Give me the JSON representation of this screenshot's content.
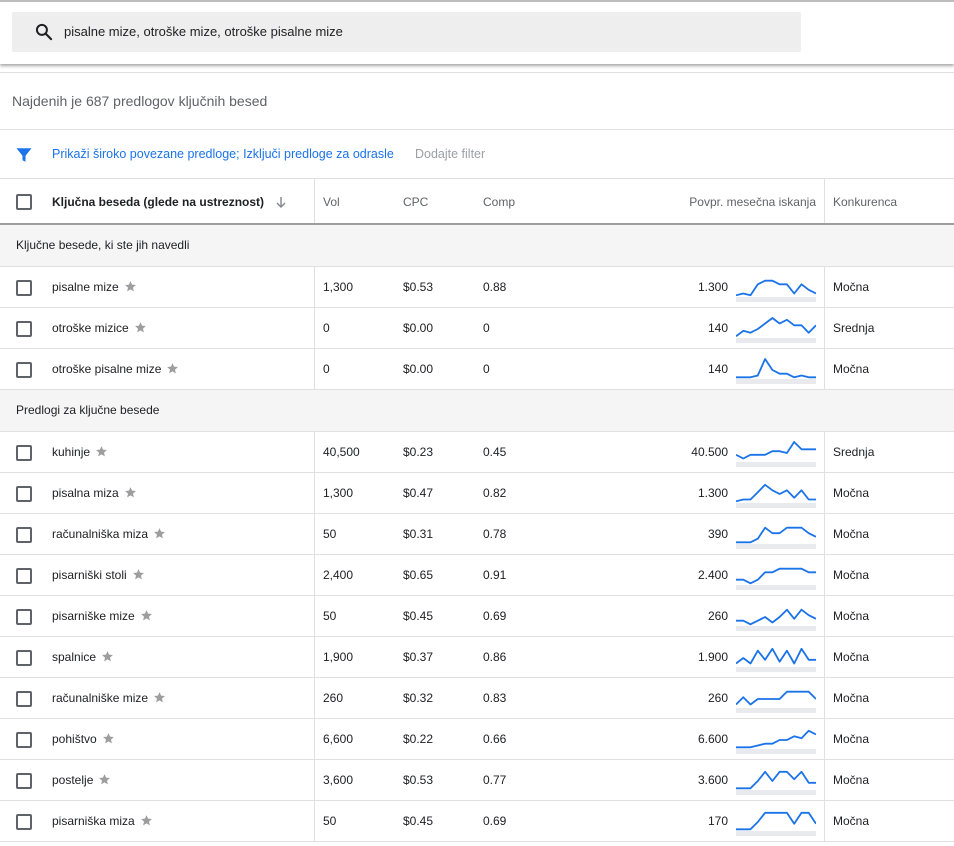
{
  "search": {
    "query": "pisalne mize, otroške mize, otroške pisalne mize",
    "icon": "search-icon"
  },
  "summary": "Najdenih je 687 predlogov ključnih besed",
  "filters": {
    "active": "Prikaži široko povezane predloge; Izključi predloge za odrasle",
    "add": "Dodajte filter",
    "icon": "filter-icon",
    "accent": "#1a73e8"
  },
  "columns": {
    "keyword": "Ključna beseda (glede na ustreznost)",
    "vol": "Vol",
    "cpc": "CPC",
    "comp": "Comp",
    "avg": "Povpr. mesečna iskanja",
    "competition": "Konkurenca"
  },
  "sections": [
    {
      "label": "Ključne besede, ki ste jih navedli",
      "rows": [
        {
          "keyword": "pisalne mize",
          "vol": "1,300",
          "cpc": "$0.53",
          "comp": "0.88",
          "avg": "1.300",
          "competition": "Močna",
          "trend": [
            2,
            3,
            2,
            8,
            10,
            10,
            8,
            8,
            3,
            8,
            5,
            3
          ]
        },
        {
          "keyword": "otroške mizice",
          "vol": "0",
          "cpc": "$0.00",
          "comp": "0",
          "avg": "140",
          "competition": "Srednja",
          "trend": [
            2,
            5,
            4,
            6,
            9,
            12,
            9,
            11,
            8,
            8,
            4,
            8
          ]
        },
        {
          "keyword": "otroške pisalne mize",
          "vol": "0",
          "cpc": "$0.00",
          "comp": "0",
          "avg": "140",
          "competition": "Močna",
          "trend": [
            2,
            2,
            2,
            3,
            12,
            6,
            4,
            4,
            2,
            3,
            2,
            2
          ]
        }
      ]
    },
    {
      "label": "Predlogi za ključne besede",
      "rows": [
        {
          "keyword": "kuhinje",
          "vol": "40,500",
          "cpc": "$0.23",
          "comp": "0.45",
          "avg": "40.500",
          "competition": "Srednja",
          "trend": [
            5,
            3,
            5,
            5,
            5,
            7,
            7,
            6,
            12,
            8,
            8,
            8
          ]
        },
        {
          "keyword": "pisalna miza",
          "vol": "1,300",
          "cpc": "$0.47",
          "comp": "0.82",
          "avg": "1.300",
          "competition": "Močna",
          "trend": [
            2,
            3,
            3,
            7,
            11,
            8,
            6,
            8,
            4,
            8,
            3,
            3
          ]
        },
        {
          "keyword": "računalniška miza",
          "vol": "50",
          "cpc": "$0.31",
          "comp": "0.78",
          "avg": "390",
          "competition": "Močna",
          "trend": [
            2,
            2,
            2,
            4,
            10,
            7,
            7,
            10,
            10,
            10,
            7,
            5
          ]
        },
        {
          "keyword": "pisarniški stoli",
          "vol": "2,400",
          "cpc": "$0.65",
          "comp": "0.91",
          "avg": "2.400",
          "competition": "Močna",
          "trend": [
            4,
            4,
            2,
            4,
            8,
            8,
            10,
            10,
            10,
            10,
            8,
            8
          ]
        },
        {
          "keyword": "pisarniške mize",
          "vol": "50",
          "cpc": "$0.45",
          "comp": "0.69",
          "avg": "260",
          "competition": "Močna",
          "trend": [
            4,
            4,
            2,
            4,
            6,
            3,
            6,
            10,
            5,
            10,
            7,
            5
          ]
        },
        {
          "keyword": "spalnice",
          "vol": "1,900",
          "cpc": "$0.37",
          "comp": "0.86",
          "avg": "1.900",
          "competition": "Močna",
          "trend": [
            3,
            6,
            3,
            10,
            5,
            11,
            4,
            10,
            3,
            11,
            5,
            5
          ]
        },
        {
          "keyword": "računalniške mize",
          "vol": "260",
          "cpc": "$0.32",
          "comp": "0.83",
          "avg": "260",
          "competition": "Močna",
          "trend": [
            3,
            7,
            3,
            6,
            6,
            6,
            6,
            10,
            10,
            10,
            10,
            6
          ]
        },
        {
          "keyword": "pohištvo",
          "vol": "6,600",
          "cpc": "$0.22",
          "comp": "0.66",
          "avg": "6.600",
          "competition": "Močna",
          "trend": [
            2,
            2,
            2,
            3,
            4,
            4,
            6,
            6,
            8,
            7,
            11,
            9
          ]
        },
        {
          "keyword": "postelje",
          "vol": "3,600",
          "cpc": "$0.53",
          "comp": "0.77",
          "avg": "3.600",
          "competition": "Močna",
          "trend": [
            2,
            2,
            2,
            6,
            11,
            6,
            11,
            11,
            7,
            11,
            5,
            5
          ]
        },
        {
          "keyword": "pisarniška miza",
          "vol": "50",
          "cpc": "$0.45",
          "comp": "0.69",
          "avg": "170",
          "competition": "Močna",
          "trend": [
            2,
            2,
            2,
            6,
            11,
            11,
            11,
            11,
            5,
            11,
            11,
            5
          ]
        }
      ]
    }
  ],
  "colors": {
    "sparkline": "#1a73e8",
    "star": "#9e9e9e"
  }
}
